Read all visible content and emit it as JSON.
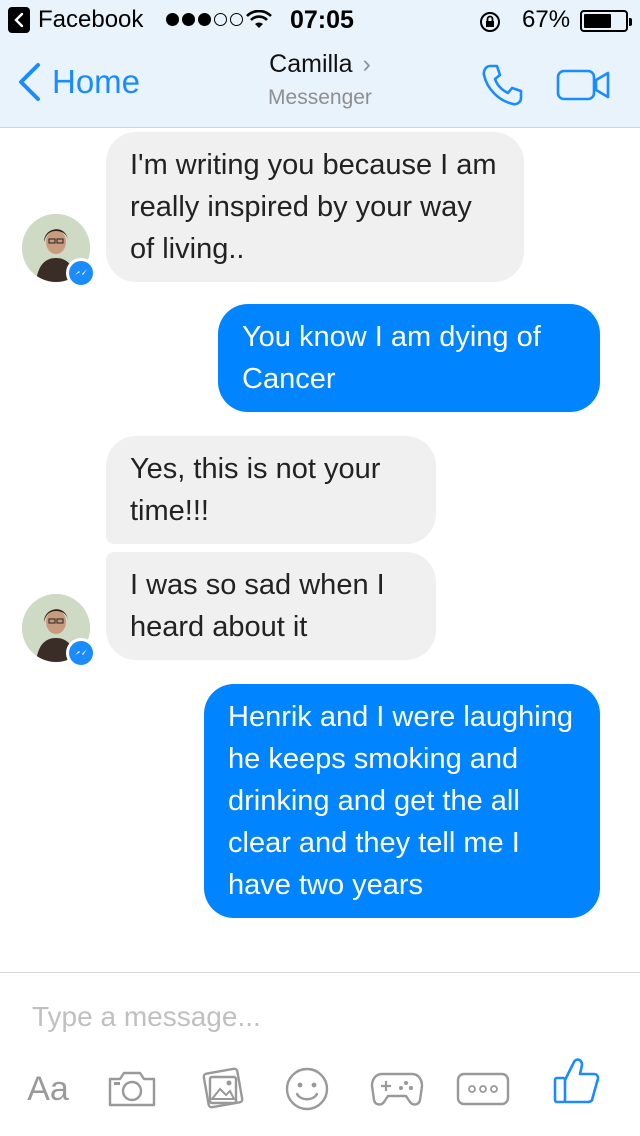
{
  "status_bar": {
    "back_app": "Facebook",
    "time": "07:05",
    "battery": "67%"
  },
  "nav": {
    "back_label": "Home",
    "title": "Camilla",
    "subtitle": "Messenger"
  },
  "messages": [
    {
      "direction": "incoming",
      "text": "I'm writing you because I am really inspired by your way of living.."
    },
    {
      "direction": "outgoing",
      "text": "You know I am dying of Cancer"
    },
    {
      "direction": "incoming",
      "text": "Yes, this is not your time!!!"
    },
    {
      "direction": "incoming",
      "text": "I was so sad when I heard about it"
    },
    {
      "direction": "outgoing",
      "text": "Henrik and I were laughing he keeps smoking and drinking and get the all clear and they tell me I have two years"
    }
  ],
  "composer": {
    "placeholder": "Type a message...",
    "text_tool_label": "Aa",
    "tools": [
      "text-icon",
      "camera-icon",
      "photo-icon",
      "emoji-icon",
      "game-controller-icon",
      "more-icon",
      "like-icon"
    ]
  },
  "colors": {
    "accent": "#0084ff",
    "incoming_bubble": "#f0f0f0",
    "nav_background": "#e9f3fb"
  }
}
